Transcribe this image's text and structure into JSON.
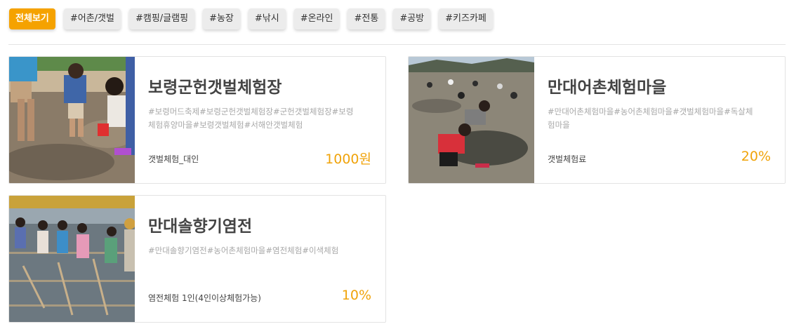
{
  "filters": {
    "items": [
      {
        "label": "전체보기",
        "active": true
      },
      {
        "label": "#어촌/갯벌",
        "active": false
      },
      {
        "label": "#캠핑/글램핑",
        "active": false
      },
      {
        "label": "#농장",
        "active": false
      },
      {
        "label": "#낚시",
        "active": false
      },
      {
        "label": "#온라인",
        "active": false
      },
      {
        "label": "#전통",
        "active": false
      },
      {
        "label": "#공방",
        "active": false
      },
      {
        "label": "#키즈카페",
        "active": false
      }
    ]
  },
  "listings": [
    {
      "title": "보령군헌갯벌체험장",
      "tags": "#보령머드축제#보령군헌갯벌체험장#군헌갯벌체험장#보령체험휴양마을#보령갯벌체험#서해안갯벌체험",
      "product": "갯벌체험_대인",
      "price": "1000원",
      "image": "children-digging-on-mudflat-photo"
    },
    {
      "title": "만대어촌체험마을",
      "tags": "#만대어촌체험마을#농어촌체험마을#갯벌체험마을#독살체험마을",
      "product": "갯벌체험료",
      "price": "20%",
      "image": "people-gathering-shellfish-on-mudflat-photo"
    },
    {
      "title": "만대솔향기염전",
      "tags": "#만대솔향기염전#농어촌체험마을#염전체험#이색체험",
      "product": "염전체험 1인(4인이상체험가능)",
      "price": "10%",
      "image": "children-raking-salt-pans-photo"
    }
  ],
  "colors": {
    "accent": "#f5a200",
    "price": "#f0a30a",
    "chip_bg": "#ececec",
    "tag_text": "#a8a8a8"
  }
}
